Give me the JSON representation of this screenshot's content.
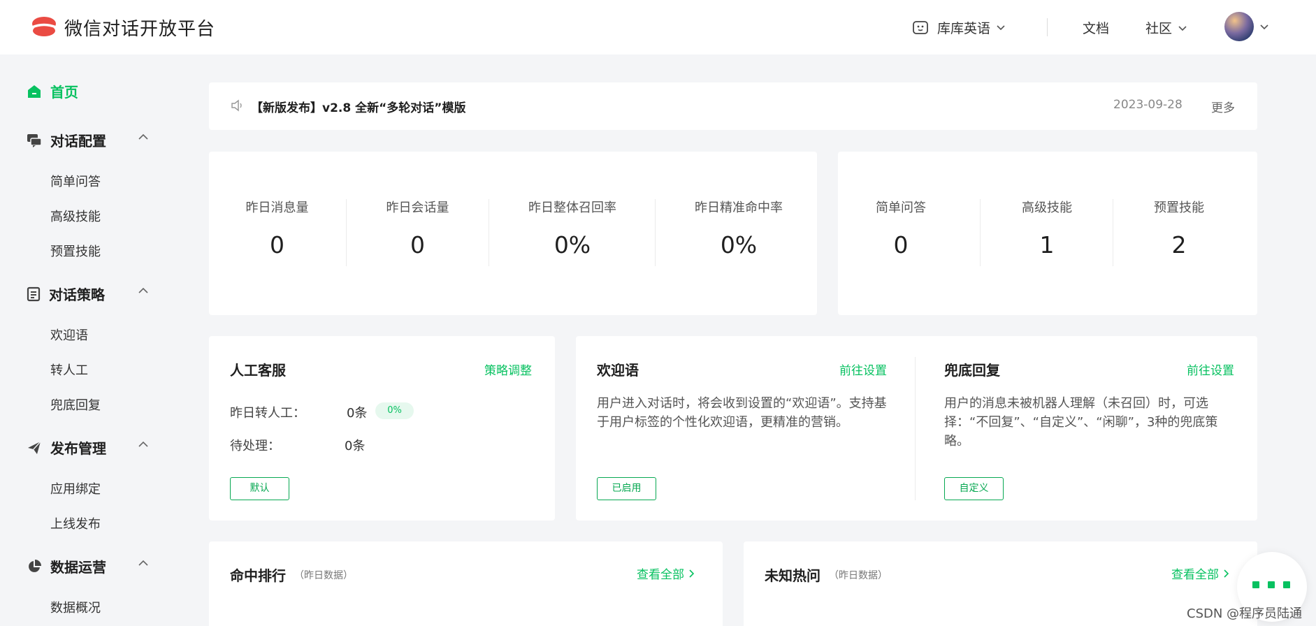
{
  "header": {
    "brand": "微信对话开放平台",
    "bot_name": "库库英语",
    "nav_docs": "文档",
    "nav_community": "社区"
  },
  "sidebar": {
    "home": "首页",
    "groups": [
      {
        "label": "对话配置",
        "items": [
          "简单问答",
          "高级技能",
          "预置技能"
        ]
      },
      {
        "label": "对话策略",
        "items": [
          "欢迎语",
          "转人工",
          "兜底回复"
        ]
      },
      {
        "label": "发布管理",
        "items": [
          "应用绑定",
          "上线发布"
        ]
      },
      {
        "label": "数据运营",
        "items": [
          "数据概况"
        ]
      }
    ]
  },
  "notice": {
    "text": "【新版发布】v2.8 全新“多轮对话”模版",
    "date": "2023-09-28",
    "more": "更多"
  },
  "stats": [
    {
      "label": "昨日消息量",
      "value": "0"
    },
    {
      "label": "昨日会话量",
      "value": "0"
    },
    {
      "label": "昨日整体召回率",
      "value": "0%"
    },
    {
      "label": "昨日精准命中率",
      "value": "0%"
    }
  ],
  "skills": [
    {
      "label": "简单问答",
      "value": "0"
    },
    {
      "label": "高级技能",
      "value": "1"
    },
    {
      "label": "预置技能",
      "value": "2"
    }
  ],
  "service": {
    "title": "人工客服",
    "link": "策略调整",
    "yesterday_label": "昨日转人工：",
    "yesterday_value": "0条",
    "yesterday_pct": "0%",
    "pending_label": "待处理：",
    "pending_value": "0条",
    "button": "默认"
  },
  "welcome": {
    "title": "欢迎语",
    "link": "前往设置",
    "desc": "用户进入对话时，将会收到设置的“欢迎语”。支持基于用户标签的个性化欢迎语，更精准的营销。",
    "button": "已启用"
  },
  "fallback": {
    "title": "兜底回复",
    "link": "前往设置",
    "desc": "用户的消息未被机器人理解（未召回）时，可选择：“不回复”、“自定义”、“闲聊”，3种的兜底策略。",
    "button": "自定义"
  },
  "rank": {
    "title": "命中排行",
    "sub": "（昨日数据）",
    "link": "查看全部"
  },
  "unknown": {
    "title": "未知热问",
    "sub": "（昨日数据）",
    "link": "查看全部"
  },
  "watermark": "CSDN @程序员陆通",
  "colors": {
    "accent": "#07c160",
    "background": "#f4f5f7"
  }
}
